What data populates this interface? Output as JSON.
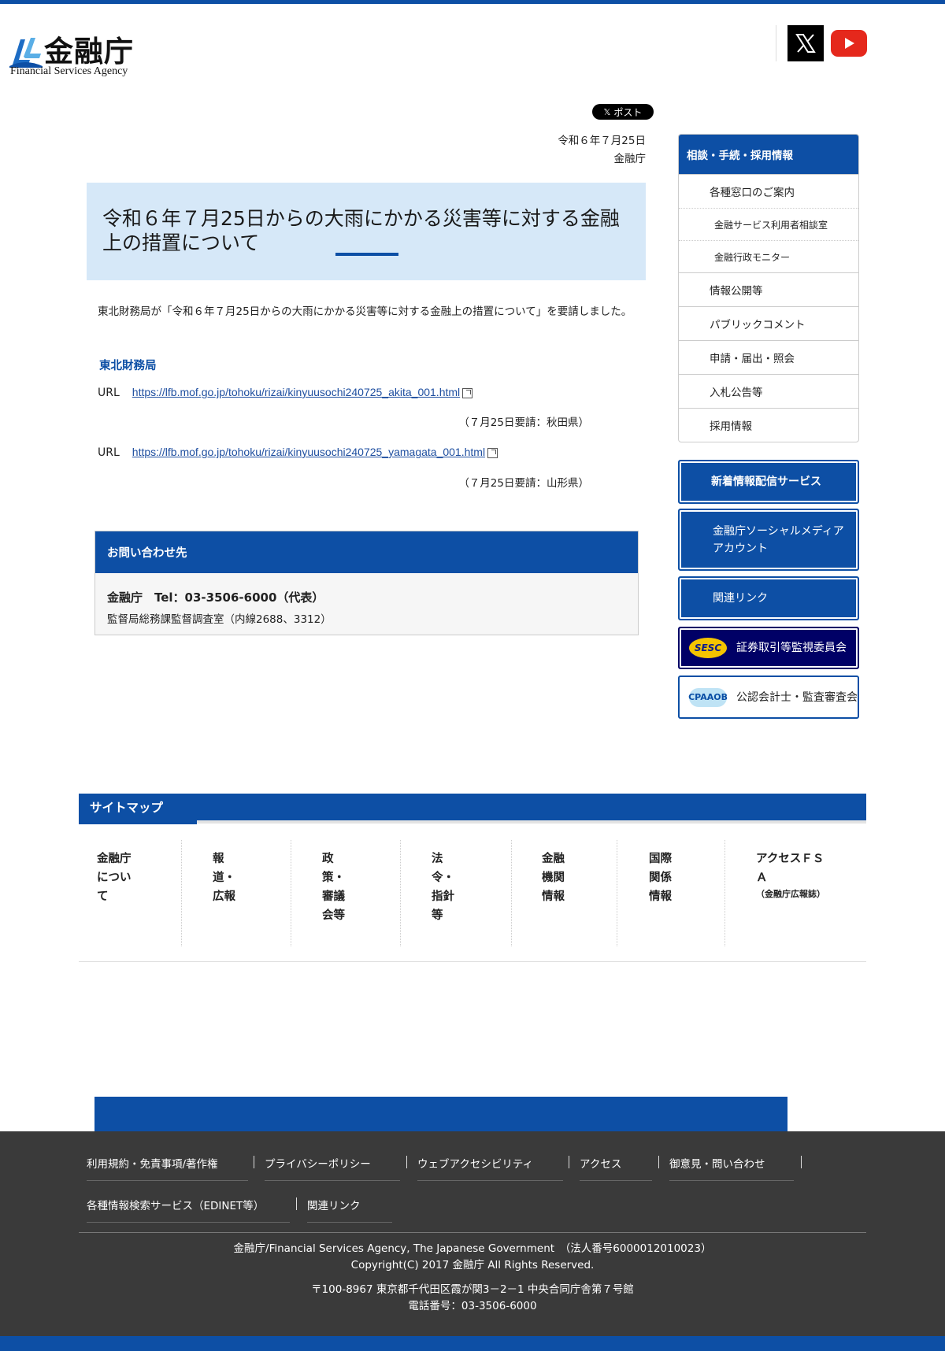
{
  "colors": {
    "brand_blue": "#0d4fa5",
    "title_bg": "#d6e8f8",
    "footer_bg": "#3a3a3a",
    "sesc_navy": "#000066"
  },
  "header": {
    "logo_ja": "金融庁",
    "logo_en": "Financial Services Agency",
    "social": [
      {
        "icon": "x-icon"
      },
      {
        "icon": "youtube-icon"
      }
    ]
  },
  "main": {
    "post_button": "ポスト",
    "date": "令和６年７月25日",
    "issuer": "金融庁",
    "title": "令和６年７月25日からの大雨にかかる災害等に対する金融上の措置について",
    "lead": "東北財務局が「令和６年７月25日からの大雨にかかる災害等に対する金融上の措置について」を要請しました。",
    "section_heading": "東北財務局",
    "links": [
      {
        "label": "URL",
        "url": "https://lfb.mof.go.jp/tohoku/rizai/kinyuusochi240725_akita_001.html",
        "note": "（７月25日要請：秋田県）"
      },
      {
        "label": "URL",
        "url": "https://lfb.mof.go.jp/tohoku/rizai/kinyuusochi240725_yamagata_001.html",
        "note": "（７月25日要請：山形県）"
      }
    ],
    "contact": {
      "heading": "お問い合わせ先",
      "line1": "金融庁　Tel：03-3506-6000（代表）",
      "line2": "監督局総務課監督調査室（内線2688、3312）"
    }
  },
  "sidebar": {
    "menu_heading": "相談・手続・採用情報",
    "menu_items": [
      {
        "label": "各種窓口のご案内",
        "sub": false
      },
      {
        "label": "金融サービス利用者相談室",
        "sub": true
      },
      {
        "label": "金融行政モニター",
        "sub": true
      },
      {
        "label": "情報公開等",
        "sub": false
      },
      {
        "label": "パブリックコメント",
        "sub": false
      },
      {
        "label": "申請・届出・照会",
        "sub": false
      },
      {
        "label": "入札公告等",
        "sub": false
      },
      {
        "label": "採用情報",
        "sub": false
      }
    ],
    "buttons": {
      "news": "新着情報配信サービス",
      "social_line1": "金融庁ソーシャルメディア",
      "social_line2": "アカウント",
      "related": "関連リンク",
      "sesc": "証券取引等監視委員会",
      "sesc_logo": "SESC",
      "cpaaob": "公認会計士・監査審査会",
      "cpaaob_logo": "CPAAOB"
    }
  },
  "sitemap": {
    "heading": "サイトマップ",
    "columns": [
      {
        "lines": [
          "金融庁",
          "につい",
          "て"
        ]
      },
      {
        "lines": [
          "報",
          "道・",
          "広報"
        ]
      },
      {
        "lines": [
          "政",
          "策・",
          "審議",
          "会等"
        ]
      },
      {
        "lines": [
          "法",
          "令・",
          "指針",
          "等"
        ]
      },
      {
        "lines": [
          "金融",
          "機関",
          "情報"
        ]
      },
      {
        "lines": [
          "国際",
          "関係",
          "情報"
        ]
      },
      {
        "lines": [
          "アクセスＦＳ",
          "Ａ"
        ],
        "small": "（金融庁広報誌）"
      }
    ]
  },
  "footer": {
    "links_row1": [
      "利用規約・免責事項/著作権",
      "プライバシーポリシー",
      "ウェブアクセシビリティ",
      "アクセス",
      "御意見・問い合わせ"
    ],
    "links_row2": [
      "各種情報検索サービス（EDINET等）",
      "関連リンク"
    ],
    "org": "金融庁/Financial Services Agency, The Japanese Government　（法人番号6000012010023）",
    "copyright": "Copyright(C) 2017 金融庁 All Rights Reserved.",
    "address": "〒100-8967 東京都千代田区霞が関3－2－1 中央合同庁舎第７号館",
    "phone": "電話番号：03-3506-6000"
  }
}
